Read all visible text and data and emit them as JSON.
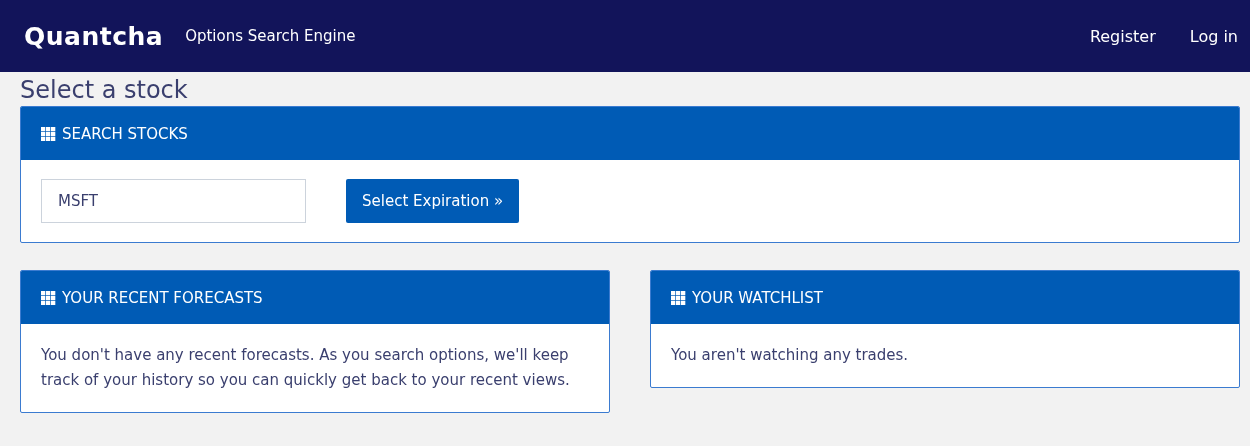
{
  "navbar": {
    "logo": "Quantcha",
    "tagline": "Options Search Engine",
    "links": [
      "Register",
      "Log in"
    ]
  },
  "page_title": "Select a stock",
  "search_panel": {
    "title": "SEARCH STOCKS",
    "input": {
      "value": "MSFT"
    },
    "button": "Select Expiration »"
  },
  "panels": [
    {
      "title": "YOUR RECENT FORECASTS",
      "text": "You don't have any recent forecasts. As you search options, we'll keep track of your history so you can quickly get back to your recent views."
    },
    {
      "title": "YOUR WATCHLIST",
      "text": "You aren't watching any trades."
    }
  ]
}
